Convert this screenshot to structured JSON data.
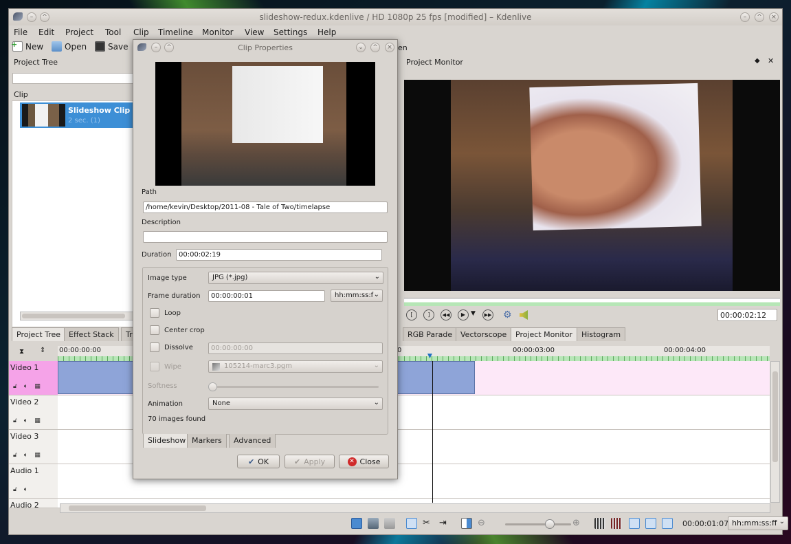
{
  "window": {
    "title": "slideshow-redux.kdenlive / HD 1080p 25 fps [modified] – Kdenlive"
  },
  "menu": [
    "File",
    "Edit",
    "Project",
    "Tool",
    "Clip",
    "Timeline",
    "Monitor",
    "View",
    "Settings",
    "Help"
  ],
  "toolbar": {
    "new_label": "New",
    "open_label": "Open",
    "save_label": "Save",
    "partial_label": "en"
  },
  "project_tree": {
    "title": "Project Tree",
    "column_header": "Clip",
    "clip": {
      "name": "Slideshow Clip",
      "info": "2 sec. (1)"
    }
  },
  "left_tabs": [
    "Project Tree",
    "Effect Stack",
    "Tr"
  ],
  "project_monitor": {
    "title": "Project Monitor",
    "timecode": "00:00:02:12"
  },
  "right_tabs": [
    "RGB Parade",
    "Vectorscope",
    "Project Monitor",
    "Histogram"
  ],
  "timeline": {
    "ruler_labels": [
      "00:00:00:00",
      "0",
      "00:00:03:00",
      "00:00:04:00"
    ],
    "tracks": [
      {
        "name": "Video 1"
      },
      {
        "name": "Video 2"
      },
      {
        "name": "Video 3"
      },
      {
        "name": "Audio 1"
      },
      {
        "name": "Audio 2"
      }
    ],
    "position": "00:00:01:07",
    "timecode_format": "hh:mm:ss:ff"
  },
  "dialog": {
    "title": "Clip Properties",
    "path_label": "Path",
    "path_value": "/home/kevin/Desktop/2011-08 - Tale of Two/timelapse",
    "description_label": "Description",
    "description_value": "",
    "duration_label": "Duration",
    "duration_value": "00:00:02:19",
    "image_type_label": "Image type",
    "image_type_value": "JPG (*.jpg)",
    "frame_duration_label": "Frame duration",
    "frame_duration_value": "00:00:00:01",
    "frame_format_value": "hh:mm:ss:f",
    "loop_label": "Loop",
    "center_crop_label": "Center crop",
    "dissolve_label": "Dissolve",
    "dissolve_value": "00:00:00:00",
    "wipe_label": "Wipe",
    "wipe_value": "105214-marc3.pgm",
    "softness_label": "Softness",
    "animation_label": "Animation",
    "animation_value": "None",
    "images_found": "70 images found",
    "tabs": [
      "Slideshow",
      "Markers",
      "Advanced"
    ],
    "ok_label": "OK",
    "apply_label": "Apply",
    "close_label": "Close"
  },
  "colors": {
    "clip_blue": "#8ea4d8",
    "track_pink": "#f5a3e8",
    "selection_blue": "#3d8fd6"
  }
}
